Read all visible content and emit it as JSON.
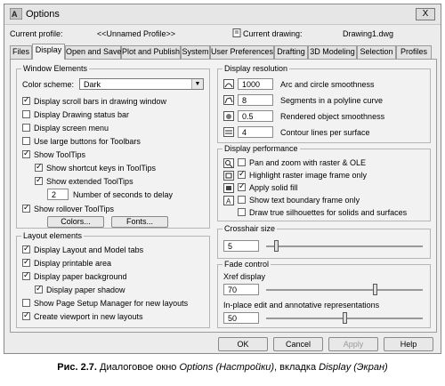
{
  "window": {
    "title": "Options",
    "close_label": "X"
  },
  "profile": {
    "current_profile_label": "Current profile:",
    "current_profile_value": "<<Unnamed Profile>>",
    "current_drawing_label": "Current drawing:",
    "current_drawing_value": "Drawing1.dwg"
  },
  "tabs": [
    {
      "label": "Files"
    },
    {
      "label": "Display"
    },
    {
      "label": "Open and Save"
    },
    {
      "label": "Plot and Publish"
    },
    {
      "label": "System"
    },
    {
      "label": "User Preferences"
    },
    {
      "label": "Drafting"
    },
    {
      "label": "3D Modeling"
    },
    {
      "label": "Selection"
    },
    {
      "label": "Profiles"
    }
  ],
  "window_elements": {
    "title": "Window Elements",
    "color_scheme_label": "Color scheme:",
    "color_scheme_value": "Dark",
    "checkboxes": [
      {
        "label": "Display scroll bars in drawing window",
        "checked": true
      },
      {
        "label": "Display Drawing status bar",
        "checked": false
      },
      {
        "label": "Display screen menu",
        "checked": false
      },
      {
        "label": "Use large buttons for Toolbars",
        "checked": false
      },
      {
        "label": "Show ToolTips",
        "checked": true
      },
      {
        "label": "Show shortcut keys in ToolTips",
        "checked": true
      },
      {
        "label": "Show extended ToolTips",
        "checked": true
      }
    ],
    "delay_value": "2",
    "delay_label": "Number of seconds to delay",
    "rollover_label": "Show rollover ToolTips",
    "rollover_checked": true,
    "colors_button": "Colors...",
    "fonts_button": "Fonts..."
  },
  "layout_elements": {
    "title": "Layout elements",
    "checkboxes": [
      {
        "label": "Display Layout and Model tabs",
        "checked": true
      },
      {
        "label": "Display printable area",
        "checked": true
      },
      {
        "label": "Display paper background",
        "checked": true
      },
      {
        "label": "Display paper shadow",
        "checked": true
      },
      {
        "label": "Show Page Setup Manager for new layouts",
        "checked": false
      },
      {
        "label": "Create viewport in new layouts",
        "checked": true
      }
    ]
  },
  "display_resolution": {
    "title": "Display resolution",
    "items": [
      {
        "value": "1000",
        "label": "Arc and circle smoothness"
      },
      {
        "value": "8",
        "label": "Segments in a polyline curve"
      },
      {
        "value": "0.5",
        "label": "Rendered object smoothness"
      },
      {
        "value": "4",
        "label": "Contour lines per surface"
      }
    ]
  },
  "display_performance": {
    "title": "Display performance",
    "items": [
      {
        "label": "Pan and zoom with raster & OLE",
        "checked": false
      },
      {
        "label": "Highlight raster image frame only",
        "checked": true
      },
      {
        "label": "Apply solid fill",
        "checked": true
      },
      {
        "label": "Show text boundary frame only",
        "checked": false
      },
      {
        "label": "Draw true silhouettes for solids and surfaces",
        "checked": false
      }
    ]
  },
  "crosshair": {
    "title": "Crosshair size",
    "value": "5",
    "level": 0.05
  },
  "fade": {
    "title": "Fade control",
    "xref_label": "Xref display",
    "xref_value": "70",
    "xref_level": 0.7,
    "inplace_label": "In-place edit and annotative representations",
    "inplace_value": "50",
    "inplace_level": 0.5
  },
  "buttons": {
    "ok": "OK",
    "cancel": "Cancel",
    "apply": "Apply",
    "help": "Help"
  },
  "caption": {
    "bold": "Рис. 2.7.",
    "text1": " Диалоговое окно ",
    "italic1": "Options (Настройки)",
    "text2": ", вкладка ",
    "italic2": "Display (Экран)"
  }
}
